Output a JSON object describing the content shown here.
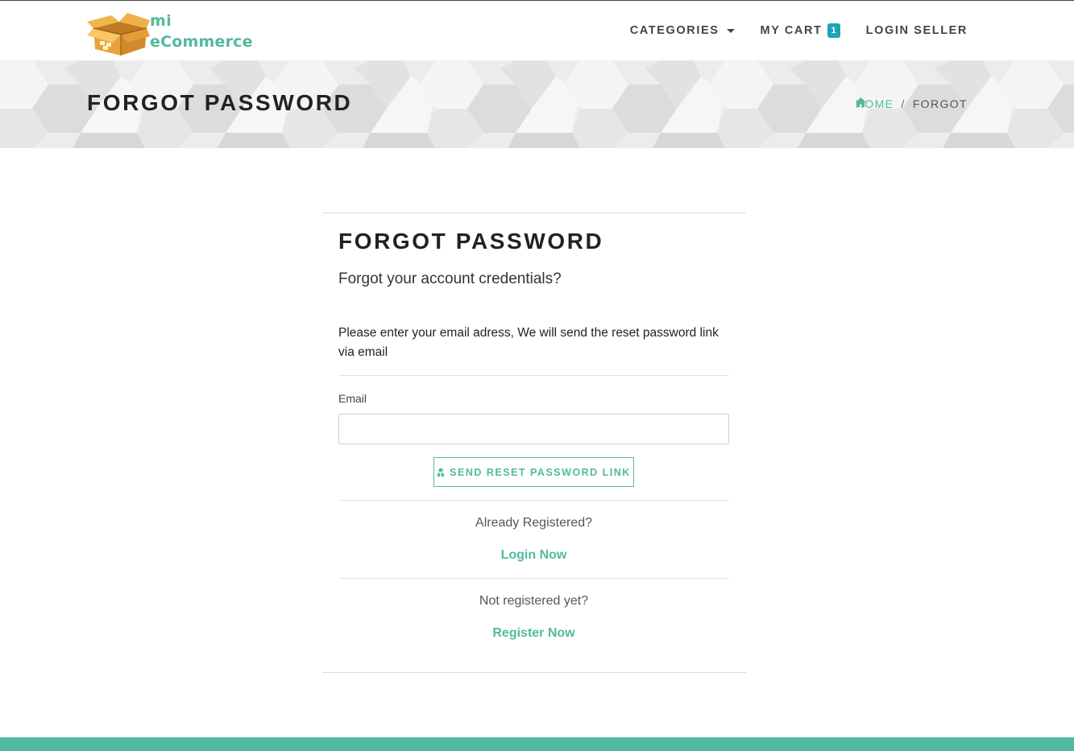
{
  "brand": {
    "line1": "mi",
    "line2": "eCommerce"
  },
  "nav": {
    "categories": "CATEGORIES",
    "cart": "MY CART",
    "cart_count": "1",
    "login_seller": "LOGIN SELLER"
  },
  "banner": {
    "title": "FORGOT PASSWORD",
    "breadcrumb_home": "HOME",
    "breadcrumb_sep": "/",
    "breadcrumb_current": "FORGOT"
  },
  "card": {
    "title": "FORGOT PASSWORD",
    "subtitle": "Forgot your account credentials?",
    "description": "Please enter your email adress, We will send the reset password link via email",
    "email_label": "Email",
    "email_value": "",
    "send_button": "SEND RESET PASSWORD LINK",
    "already_registered": "Already Registered?",
    "login_link": "Login Now",
    "not_registered": "Not registered yet?",
    "register_link": "Register Now"
  },
  "colors": {
    "accent": "#52b9a0",
    "badge": "#1aa4b8",
    "banner_bg": "#ececec"
  }
}
